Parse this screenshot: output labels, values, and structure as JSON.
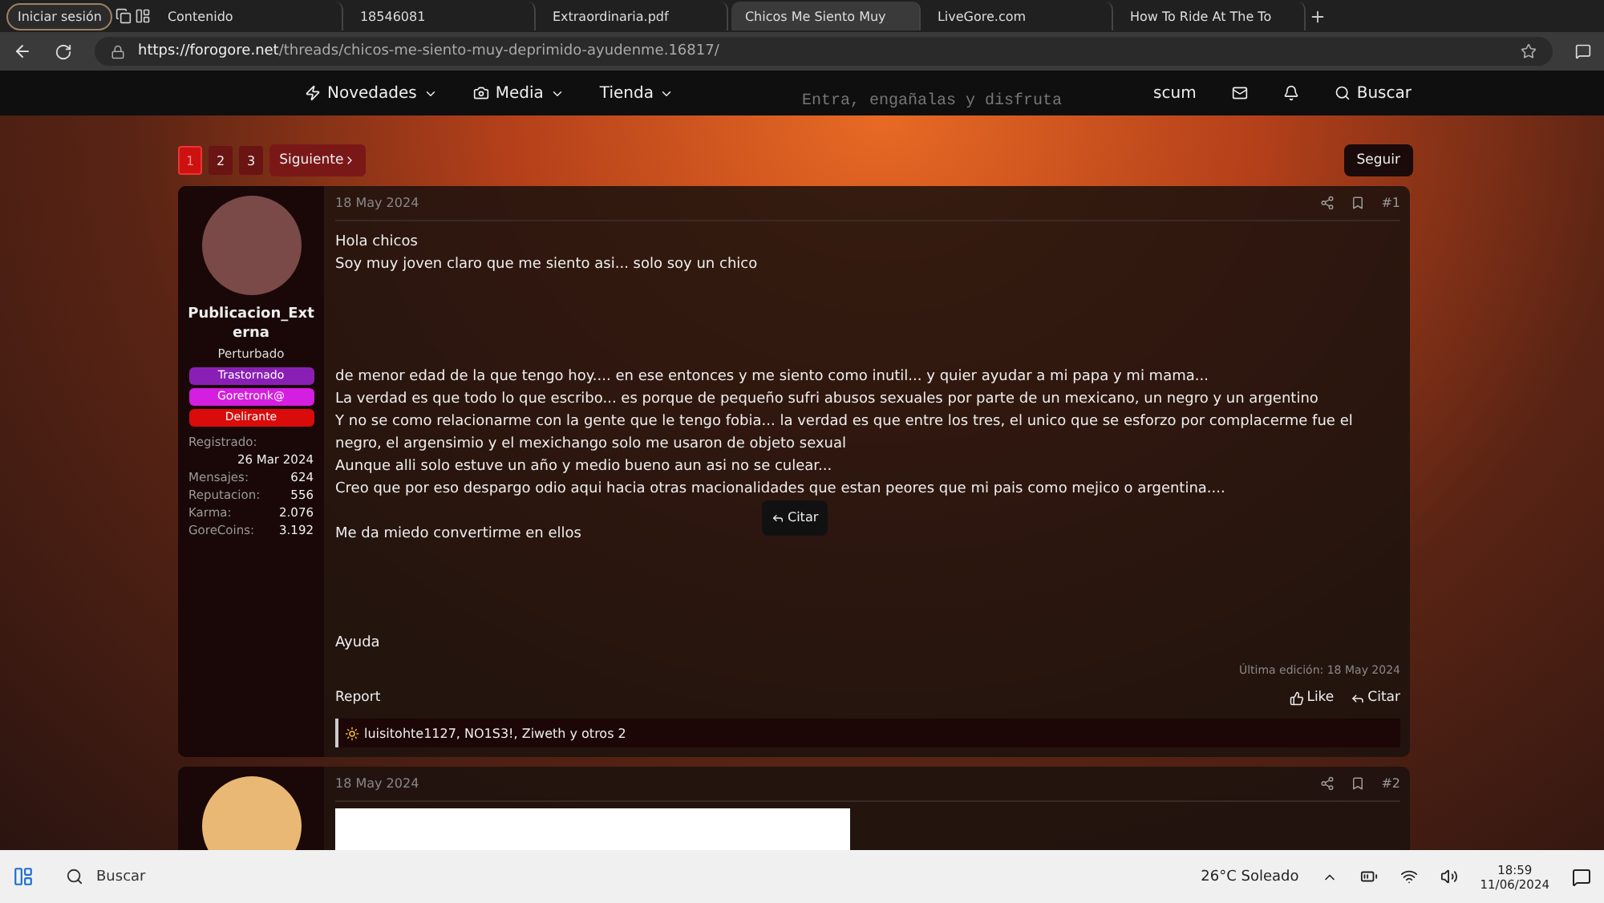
{
  "browser": {
    "profile": "Iniciar sesión",
    "tabs": [
      {
        "title": "Contenido",
        "selected": false
      },
      {
        "title": "18546081",
        "selected": false
      },
      {
        "title": "Extraordinaria.pdf",
        "selected": false
      },
      {
        "title": "Chicos Me Siento Muy",
        "selected": true
      },
      {
        "title": "LiveGore.com",
        "selected": false
      },
      {
        "title": "How To Ride At The To",
        "selected": false
      }
    ],
    "url_host": "https://forogore.net",
    "url_path": "/threads/chicos-me-siento-muy-deprimido-ayudenme.16817/"
  },
  "nav": {
    "items": [
      "Novedades",
      "Media",
      "Tienda"
    ],
    "user": "scum",
    "search": "Buscar",
    "banner": "Entra, engañalas y disfruta"
  },
  "pagination": {
    "pages": [
      {
        "label": "1",
        "selected": true
      },
      {
        "label": "2",
        "selected": false
      },
      {
        "label": "3",
        "selected": false
      }
    ],
    "next": "Siguiente",
    "follow": "Seguir"
  },
  "post": {
    "date": "18 May 2024",
    "number": "#1",
    "author": "Publicacion_Externa",
    "title": "Perturbado",
    "badges": [
      {
        "label": "Trastornado",
        "color": "#8a1fb5"
      },
      {
        "label": "Goretronk@",
        "color": "#d41ee0"
      },
      {
        "label": "Delirante",
        "color": "#d90b0b"
      }
    ],
    "registered_label": "Registrado:",
    "registered": "26 Mar 2024",
    "stats": [
      {
        "label": "Mensajes:",
        "value": "624"
      },
      {
        "label": "Reputacion:",
        "value": "556"
      },
      {
        "label": "Karma:",
        "value": "2.076"
      },
      {
        "label": "GoreCoins:",
        "value": "3.192"
      }
    ],
    "paragraphs": [
      [
        "Hola chicos",
        "Soy muy joven claro que me siento asi... solo soy un chico"
      ],
      [
        "de menor edad de la que tengo hoy.... en ese entonces y me siento como inutil... y quier ayudar a mi papa y mi mama...",
        "La verdad es que todo lo que escribo... es porque de pequeño sufri abusos sexuales por parte de un mexicano, un negro y un argentino",
        "Y no se como relacionarme con la gente que le tengo fobia... la verdad es que entre los tres, el unico que se esforzo por complacerme fue el negro, el argensimio y el mexichango solo me usaron de objeto sexual",
        "Aunque alli solo estuve un año y medio bueno aun asi no se culear...",
        "Creo que por eso despargo odio aqui hacia otras macionalidades que estan peores que mi pais como mejico o argentina...."
      ],
      [
        "Me da miedo convertirme en ellos"
      ],
      [
        "Ayuda"
      ]
    ],
    "quote_tooltip": "Citar",
    "edited": "Última edición: 18 May 2024",
    "report": "Report",
    "like": "Like",
    "quote": "Citar",
    "reactions": "luisitohte1127, NO1S3!, Ziweth y otros 2"
  },
  "post2": {
    "date": "18 May 2024",
    "number": "#2"
  },
  "taskbar": {
    "search": "Buscar",
    "weather": "26°C Soleado",
    "time": "18:59",
    "date": "11/06/2024"
  }
}
